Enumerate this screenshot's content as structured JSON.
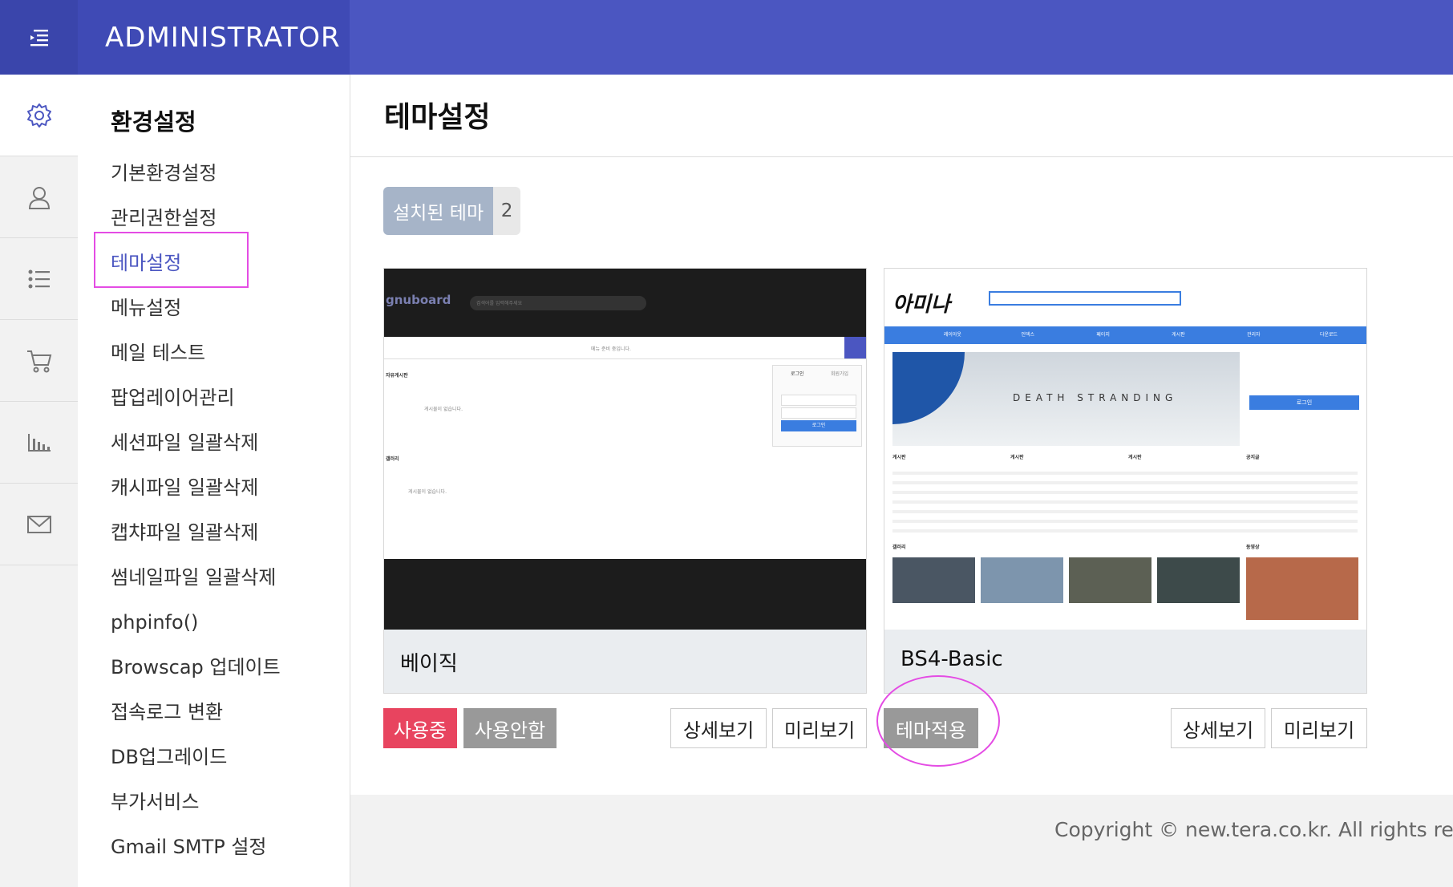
{
  "topbar": {
    "brand": "ADMINISTRATOR",
    "menu_icon": "menu-collapse-icon"
  },
  "iconbar": [
    {
      "icon": "gear-icon",
      "active": true
    },
    {
      "icon": "user-icon",
      "active": false
    },
    {
      "icon": "list-icon",
      "active": false
    },
    {
      "icon": "cart-icon",
      "active": false
    },
    {
      "icon": "bar-chart-icon",
      "active": false
    },
    {
      "icon": "mail-icon",
      "active": false
    }
  ],
  "submenu": {
    "title": "환경설정",
    "items": [
      "기본환경설정",
      "관리권한설정",
      "테마설정",
      "메뉴설정",
      "메일 테스트",
      "팝업레이어관리",
      "세션파일 일괄삭제",
      "캐시파일 일괄삭제",
      "캡챠파일 일괄삭제",
      "썸네일파일 일괄삭제",
      "phpinfo()",
      "Browscap 업데이트",
      "접속로그 변환",
      "DB업그레이드",
      "부가서비스",
      "Gmail SMTP 설정"
    ],
    "active_index": 2
  },
  "main": {
    "title": "테마설정",
    "installed_label": "설치된 테마",
    "installed_count": "2",
    "themes": [
      {
        "name": "베이직",
        "buttons": [
          "사용중",
          "사용안함",
          "상세보기",
          "미리보기"
        ],
        "preview": {
          "logo": "gnuboard",
          "search_placeholder": "검색어를 입력해주세요",
          "notice": "메뉴 준비 중입니다.",
          "board1": "자유게시판",
          "board2": "갤러리",
          "empty": "게시물이 없습니다.",
          "login_tab": "로그인",
          "join_tab": "회원가입",
          "login_btn": "로그인"
        }
      },
      {
        "name": "BS4-Basic",
        "buttons": [
          "테마적용",
          "상세보기",
          "미리보기"
        ],
        "preview": {
          "logo": "아미나",
          "nav": [
            "레이아웃",
            "인덱스",
            "페이지",
            "게시판",
            "관리자",
            "다운로드"
          ],
          "banner_title": "DEATH STRANDING",
          "login_btn": "로그인",
          "sections": [
            "게시판",
            "게시판",
            "게시판",
            "공지글"
          ],
          "gallery": "갤러리",
          "video": "동영상"
        }
      }
    ]
  },
  "footer": {
    "copyright": "Copyright © new.tera.co.kr. All rights reserve"
  },
  "colors": {
    "topbar": "#4b56c1",
    "active_use": "#e8445f",
    "annotation": "#e44ce4"
  }
}
